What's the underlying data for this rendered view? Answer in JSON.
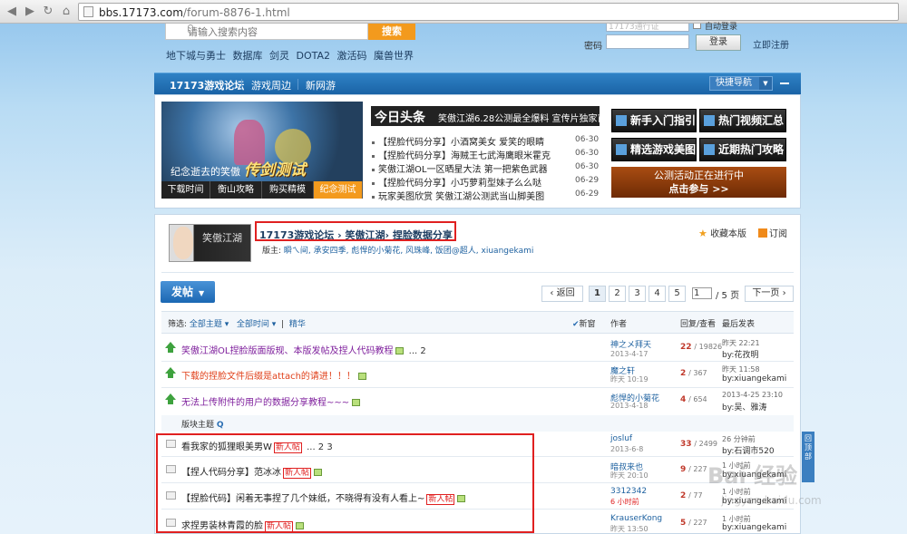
{
  "browser": {
    "url_domain": "bbs.17173.com",
    "url_path": "/forum-8876-1.html"
  },
  "header": {
    "search_placeholder": "请输入搜索内容",
    "search_button": "搜索",
    "quick_links": [
      "地下城与勇士",
      "数据库",
      "剑灵",
      "DOTA2",
      "激活码",
      "魔兽世界"
    ],
    "login": {
      "username_placeholder": "17173通行证",
      "remember_label": "自动登录",
      "password_label": "密码",
      "login_button": "登录",
      "register_link": "立即注册"
    }
  },
  "navbar": {
    "items": [
      "17173游戏论坛",
      "游戏周边",
      "新网游"
    ],
    "quick_nav": "快捷导航"
  },
  "banner": {
    "image_caption_small": "纪念逝去的笑傲",
    "image_caption_big": "传剑测试",
    "tabs": [
      "下载时间",
      "衡山攻略",
      "购买精模",
      "纪念测试"
    ],
    "headline_label": "今日头条",
    "headline_text": "笑傲江湖6.28公测最全爆料 宣传片独家首发",
    "news": [
      {
        "title": "【捏脸代码分享】小酒窝美女 爱笑的眼睛",
        "date": "06-30"
      },
      {
        "title": "【捏脸代码分享】海贼王七武海鹰眼米霍克",
        "date": "06-30"
      },
      {
        "title": "笑傲江湖OL一区晒星大法 第一把紫色武器",
        "date": "06-30"
      },
      {
        "title": "【捏脸代码分享】小巧萝莉型妹子么么哒",
        "date": "06-29"
      },
      {
        "title": "玩家美图欣赏 笑傲江湖公测武当山脚美图",
        "date": "06-29"
      }
    ],
    "buttons": [
      "新手入门指引",
      "热门视频汇总",
      "精选游戏美图",
      "近期热门攻略"
    ],
    "promo_line1": "公测活动正在进行中",
    "promo_line2": "点击参与 >>"
  },
  "forum": {
    "logo_text": "笑傲江湖",
    "breadcrumb": [
      "17173游戏论坛",
      "笑傲江湖",
      "捏脸数据分享"
    ],
    "moderators_label": "版主:",
    "moderators": "瞬ㄟ间, 承安四季, 彪悍的小菊花, 风珠峰, 饭团@超人, xiuangekami",
    "favorite": "收藏本版",
    "subscribe": "订阅",
    "post_button": "发帖",
    "pager": {
      "back": "返回",
      "pages": [
        "1",
        "2",
        "3",
        "4",
        "5"
      ],
      "current_input": "1",
      "total": "/ 5 页",
      "next": "下一页"
    },
    "filter": {
      "label": "筛选:",
      "topic": "全部主题",
      "time": "全部时间",
      "digest": "精华",
      "new": "新窗"
    },
    "columns": {
      "author": "作者",
      "replies": "回复/查看",
      "last": "最后发表"
    },
    "section_label": "版块主题",
    "threads": [
      {
        "title": "笑傲江湖OL捏脸版面版规、本版发帖及捏人代码教程",
        "pages": "... 2",
        "author": "神之メ拜天",
        "date": "2013-4-17",
        "replies": "22",
        "views": "/ 19826",
        "last_time": "昨天 22:21",
        "last_by": "by:花孜明"
      },
      {
        "title": "下载的捏脸文件后缀是attach的请进！！！",
        "author": "魔之轩",
        "date": "昨天 10:19",
        "replies": "2",
        "views": "/ 367",
        "last_time": "昨天 11:58",
        "last_by": "by:xiuangekami"
      },
      {
        "title": "无法上传附件的用户的数据分享教程~~~",
        "author": "彪悍的小菊花",
        "date": "2013-4-18",
        "replies": "4",
        "views": "/ 654",
        "last_time": "2013-4-25 23:10",
        "last_by": "by:吴、雅涛"
      },
      {
        "title": "看我家的狐狸眼美男W",
        "badge": "新人帖",
        "pages": "... 2  3",
        "author": "josluf",
        "date": "2013-6-8",
        "replies": "33",
        "views": "/ 2499",
        "last_time": "26 分钟前",
        "last_by": "by:石调市520"
      },
      {
        "title": "【捏人代码分享】范冰冰",
        "badge": "新人帖",
        "author": "暗叔来也",
        "date": "昨天 20:10",
        "replies": "9",
        "views": "/ 227",
        "last_time": "1 小时前",
        "last_by": "by:xiuangekami"
      },
      {
        "title": "【捏脸代码】闲着无事捏了几个妹纸，不晓得有没有人看上~",
        "badge": "新人帖",
        "author": "3312342",
        "date": "6 小时前",
        "replies": "2",
        "views": "/ 77",
        "last_time": "1 小时前",
        "last_by": "by:xiuangekami"
      },
      {
        "title": "求捏男装林青霞的脸",
        "badge": "新人帖",
        "author": "KrauserKong",
        "date": "昨天 13:50",
        "replies": "5",
        "views": "/ 227",
        "last_time": "1 小时前",
        "last_by": "by:xiuangekami"
      }
    ],
    "side_tab": "回顶部"
  },
  "watermark": {
    "main": "Bai 经验",
    "sub": "jingyan.baidu.com"
  }
}
